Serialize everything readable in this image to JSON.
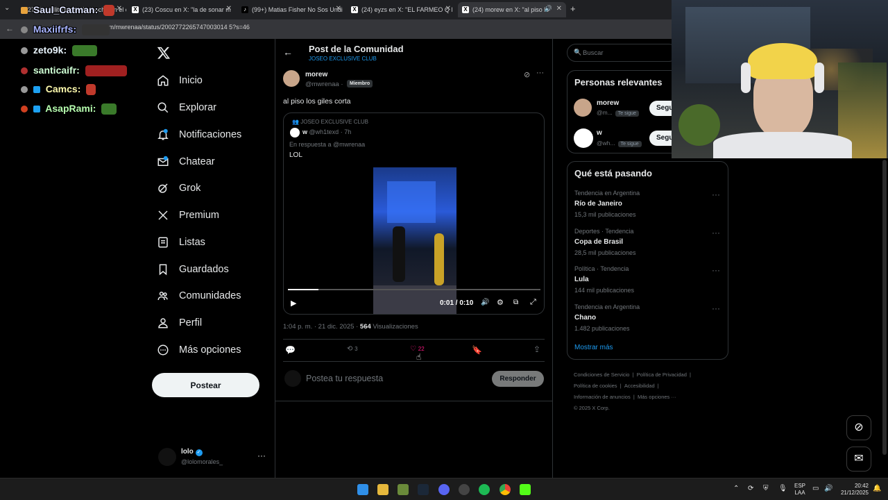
{
  "browser": {
    "tabs": [
      {
        "label": "(27) Cavallito en X: \"La bocha en el cuerdo"
      },
      {
        "label": "(23) Coscu en X: \"la de sonar m"
      },
      {
        "label": "(99+) Matias Fisher No Sos Undi"
      },
      {
        "label": "(24) eyzs en X: \"EL FARMEO Q l"
      },
      {
        "label": "(24) morew en X: \"al piso lo"
      }
    ],
    "url": "x.com/mwrenaa/status/2002772265747003014 5?s=46"
  },
  "chat": [
    {
      "user": "Saul_Catman:",
      "color": "#dfe4ff"
    },
    {
      "user": "Maxiifrfs:",
      "color": "#a8b4ff"
    },
    {
      "user": "zeto9k:",
      "color": "#eaf6ff"
    },
    {
      "user": "santicaifr:",
      "color": "#cfffd5"
    },
    {
      "user": "Camcs:",
      "color": "#fffbae"
    },
    {
      "user": "AsapRami:",
      "color": "#b7ffb0"
    }
  ],
  "nav": {
    "items": [
      {
        "label": "Inicio",
        "icon": "home-icon"
      },
      {
        "label": "Explorar",
        "icon": "search-icon"
      },
      {
        "label": "Notificaciones",
        "icon": "bell-icon"
      },
      {
        "label": "Chatear",
        "icon": "mail-icon"
      },
      {
        "label": "Grok",
        "icon": "grok-icon"
      },
      {
        "label": "Premium",
        "icon": "x-logo-icon"
      },
      {
        "label": "Listas",
        "icon": "list-icon"
      },
      {
        "label": "Guardados",
        "icon": "bookmark-icon"
      },
      {
        "label": "Comunidades",
        "icon": "communities-icon"
      },
      {
        "label": "Perfil",
        "icon": "profile-icon"
      },
      {
        "label": "Más opciones",
        "icon": "more-icon"
      }
    ],
    "post_label": "Postear",
    "account": {
      "name": "lolo",
      "handle": "@lolomorales_"
    }
  },
  "header": {
    "title": "Post de la Comunidad",
    "community": "JOSEO EXCLUSIVE CLUB"
  },
  "post": {
    "author": "morew",
    "handle": "@mwrenaa",
    "role": "Miembro",
    "text": "al piso los giles corta",
    "quoted": {
      "community": "JOSEO EXCLUSIVE CLUB",
      "author": "w",
      "handle": "@wh1texd",
      "time": "7h",
      "reply_to": "En respuesta a @mwrenaa",
      "text": "LOL",
      "video_time": "0:01 / 0:10",
      "video_progress": 0.12
    },
    "meta_time": "1:04 p. m. · 21 dic. 2025 · ",
    "views": "564",
    "views_label": "Visualizaciones",
    "reposts": "3",
    "likes": "22",
    "reply_placeholder": "Postea tu respuesta",
    "reply_button": "Responder"
  },
  "sidebar": {
    "search_placeholder": "Buscar",
    "relevant_title": "Personas relevantes",
    "people": [
      {
        "name": "morew",
        "handle": "@m...",
        "tag": "Te sigue",
        "button": "Seguir"
      },
      {
        "name": "w",
        "handle": "@wh...",
        "tag": "Te sigue",
        "button": "Seguir"
      }
    ],
    "trending_title": "Qué está pasando",
    "trends": [
      {
        "category": "Tendencia en Argentina",
        "name": "Río de Janeiro",
        "count": "15,3 mil publicaciones"
      },
      {
        "category": "Deportes · Tendencia",
        "name": "Copa de Brasil",
        "count": "28,5 mil publicaciones"
      },
      {
        "category": "Política · Tendencia",
        "name": "Lula",
        "count": "144 mil publicaciones"
      },
      {
        "category": "Tendencia en Argentina",
        "name": "Chano",
        "count": "1.482 publicaciones"
      }
    ],
    "show_more": "Mostrar más",
    "footer": {
      "l1a": "Condiciones de Servicio",
      "l1b": "Política de Privacidad",
      "l2a": "Política de cookies",
      "l2b": "Accesibilidad",
      "l3a": "Información de anuncios",
      "l3b": "Más opciones ···",
      "copy": "© 2025 X Corp."
    }
  },
  "taskbar": {
    "lang": "ESP",
    "lang2": "LAA",
    "time": "20:42",
    "date": "21/12/2025"
  }
}
